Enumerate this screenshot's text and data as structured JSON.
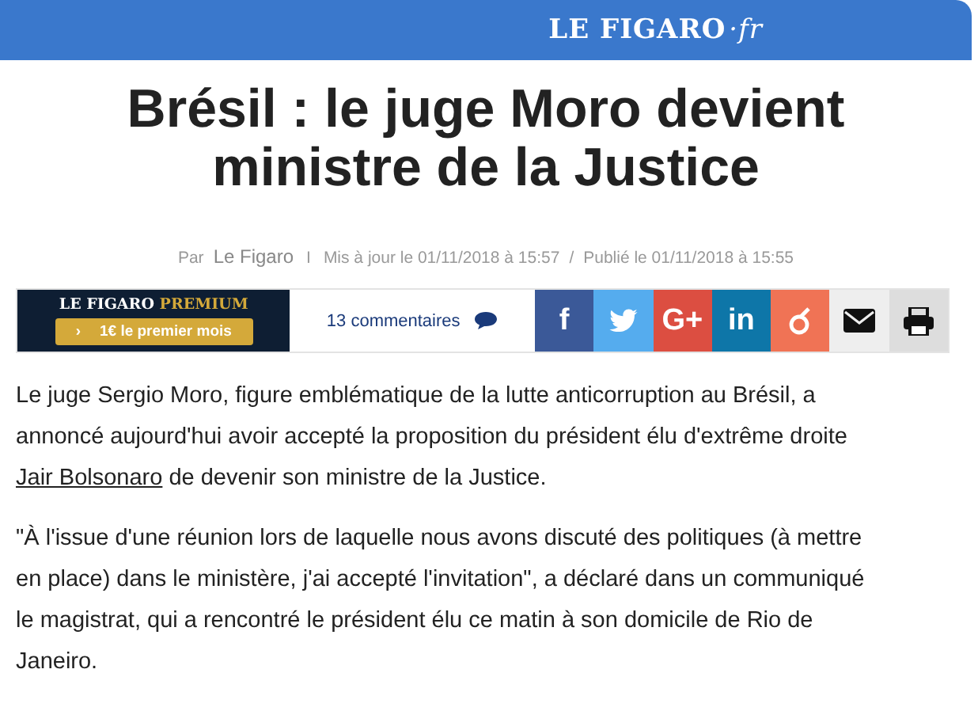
{
  "header": {
    "logo": "LE FIGARO",
    "suffix": "·fr"
  },
  "title_lines": [
    "Brésil : le juge Moro devient",
    "ministre de la Justice"
  ],
  "byline": {
    "prefix": "Par",
    "author": "Le Figaro",
    "separator": "I",
    "updated": "Mis à jour le 01/11/2018 à 15:57",
    "slash": "/",
    "published": "Publié le 01/11/2018 à 15:55"
  },
  "premium": {
    "brand": "LE FIGARO",
    "tier": "PREMIUM",
    "cta_arrow": "›",
    "cta": "1€ le premier mois"
  },
  "comments": {
    "label": "13 commentaires"
  },
  "share_buttons": [
    {
      "kind": "letter",
      "label": "f",
      "color": "#3b5998"
    },
    {
      "kind": "bird",
      "color": "#55acee"
    },
    {
      "kind": "letter",
      "label": "G+",
      "color": "#dc4e41"
    },
    {
      "kind": "letter",
      "label": "in",
      "color": "#0e76a8"
    },
    {
      "kind": "fruit",
      "color": "#f07355"
    },
    {
      "kind": "mail",
      "color": "#eeeeee"
    },
    {
      "kind": "print",
      "color": "#dddddd"
    }
  ],
  "paragraphs": [
    {
      "lines": [
        [
          {
            "text": "Le juge Sergio Moro, figure emblématique de la lutte anticorruption au Brésil, a",
            "link": false
          }
        ],
        [
          {
            "text": "annoncé aujourd'hui avoir accepté la proposition du président élu d'extrême droite",
            "link": false
          }
        ],
        [
          {
            "text": "Jair Bolsonaro",
            "link": true
          },
          {
            "text": " de devenir son ministre de la Justice.",
            "link": false
          }
        ]
      ]
    },
    {
      "lines": [
        [
          {
            "text": "\"À l'issue d'une réunion lors de laquelle nous avons discuté des politiques (à mettre",
            "link": false
          }
        ],
        [
          {
            "text": "en place) dans le ministère, j'ai accepté l'invitation\", a déclaré dans un communiqué",
            "link": false
          }
        ],
        [
          {
            "text": "le magistrat, qui a rencontré le président élu ce matin à son domicile de Rio de",
            "link": false
          }
        ],
        [
          {
            "text": "Janeiro.",
            "link": false
          }
        ]
      ]
    }
  ]
}
